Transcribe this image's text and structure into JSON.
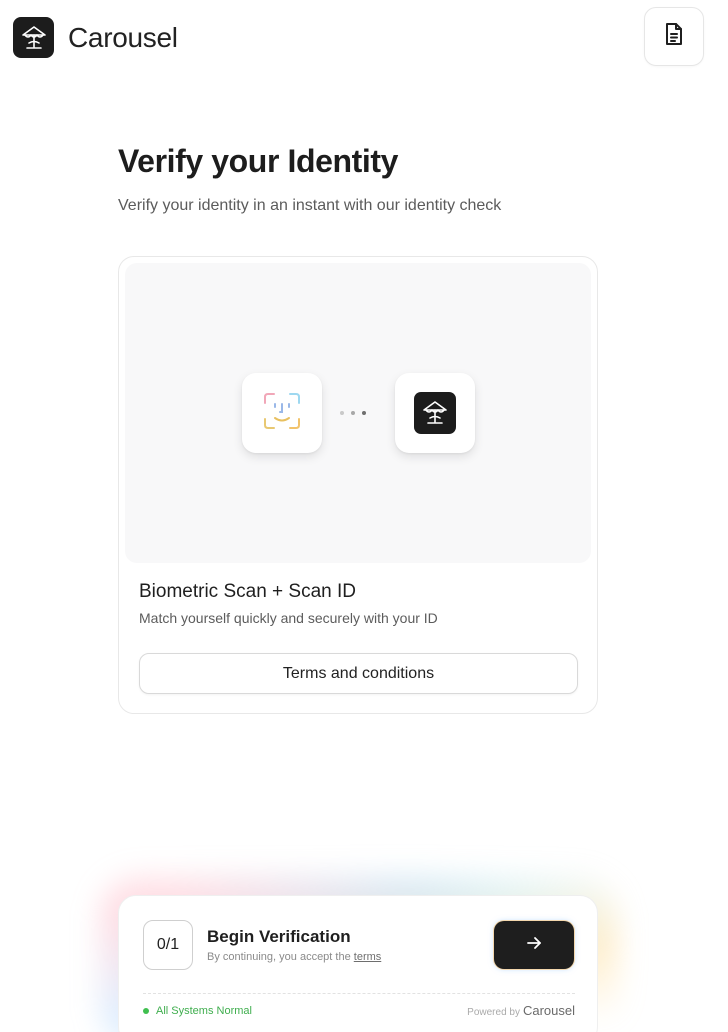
{
  "header": {
    "brand_name": "Carousel",
    "logo_icon": "carousel-tree-logo",
    "doc_icon": "document-icon"
  },
  "main": {
    "title": "Verify your Identity",
    "subtitle": "Verify your identity in an instant with our identity check"
  },
  "card": {
    "illustration": {
      "left_icon": "face-id-icon",
      "middle_icon": "ellipsis-dots",
      "right_icon": "carousel-tree-logo"
    },
    "title": "Biometric Scan + Scan ID",
    "description": "Match yourself quickly and securely with your ID",
    "terms_button_label": "Terms and conditions"
  },
  "verification_panel": {
    "counter": "0/1",
    "title": "Begin Verification",
    "note_prefix": "By continuing, you accept the ",
    "note_link": "terms",
    "go_icon": "arrow-right-icon",
    "status_text": "All Systems Normal",
    "status_color": "#3fbf4f",
    "powered_prefix": "Powered by",
    "powered_brand": "Carousel"
  }
}
